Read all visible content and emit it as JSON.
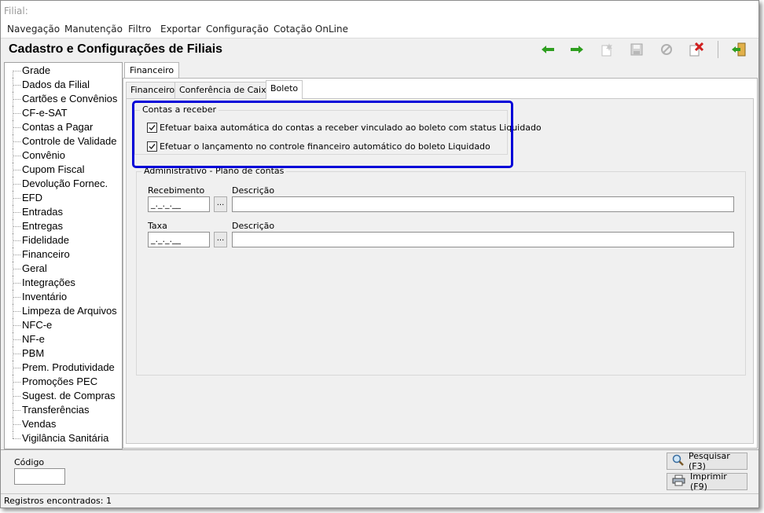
{
  "window": {
    "title": "Filial:"
  },
  "menu": [
    "Navegação",
    "Manutenção",
    "Filtro",
    "Exportar",
    "Configuração",
    "Cotação OnLine"
  ],
  "header": {
    "title": "Cadastro e Configurações de Filiais"
  },
  "toolbar": {
    "icons": [
      "arrow-left-icon",
      "arrow-right-icon",
      "new-record-icon",
      "save-icon",
      "cancel-icon",
      "delete-icon",
      "exit-icon"
    ],
    "colors": {
      "arrow": "#2e9e1f",
      "delete": "#d02020",
      "exit": "#2e9e1f"
    }
  },
  "sidebar": {
    "items": [
      "Grade",
      "Dados da Filial",
      "Cartões e Convênios",
      "CF-e-SAT",
      "Contas a Pagar",
      "Controle de Validade",
      "Convênio",
      "Cupom Fiscal",
      "Devolução Fornec.",
      "EFD",
      "Entradas",
      "Entregas",
      "Fidelidade",
      "Financeiro",
      "Geral",
      "Integrações",
      "Inventário",
      "Limpeza de Arquivos",
      "NFC-e",
      "NF-e",
      "PBM",
      "Prem. Produtividade",
      "Promoções PEC",
      "Sugest. de Compras",
      "Transferências",
      "Vendas",
      "Vigilância Sanitária"
    ]
  },
  "main": {
    "outer_tab": "Financeiro",
    "tabs": [
      "Financeiro",
      "Conferência de Caixa",
      "Boleto"
    ],
    "active_tab": "Boleto",
    "contas_receber": {
      "legend": "Contas a receber",
      "check1": "Efetuar baixa automática do contas a receber vinculado ao boleto com status Liquidado",
      "check2": "Efetuar o lançamento no controle financeiro automático do boleto Liquidado",
      "check1_checked": true,
      "check2_checked": true
    },
    "plano_contas": {
      "legend": "Administrativo - Plano de contas",
      "recebimento_label": "Recebimento",
      "recebimento_value": "_._._.__",
      "descricao1_label": "Descrição",
      "descricao1_value": "",
      "taxa_label": "Taxa",
      "taxa_value": "_._._.__",
      "descricao2_label": "Descrição",
      "descricao2_value": "",
      "lookup_label": "..."
    },
    "highlight_color": "#0000d8"
  },
  "bottom": {
    "codigo_label": "Código",
    "codigo_value": "",
    "pesquisar_label": "Pesquisar (F3)",
    "imprimir_label": "Imprimir (F9)"
  },
  "status": {
    "text": "Registros encontrados: 1"
  }
}
